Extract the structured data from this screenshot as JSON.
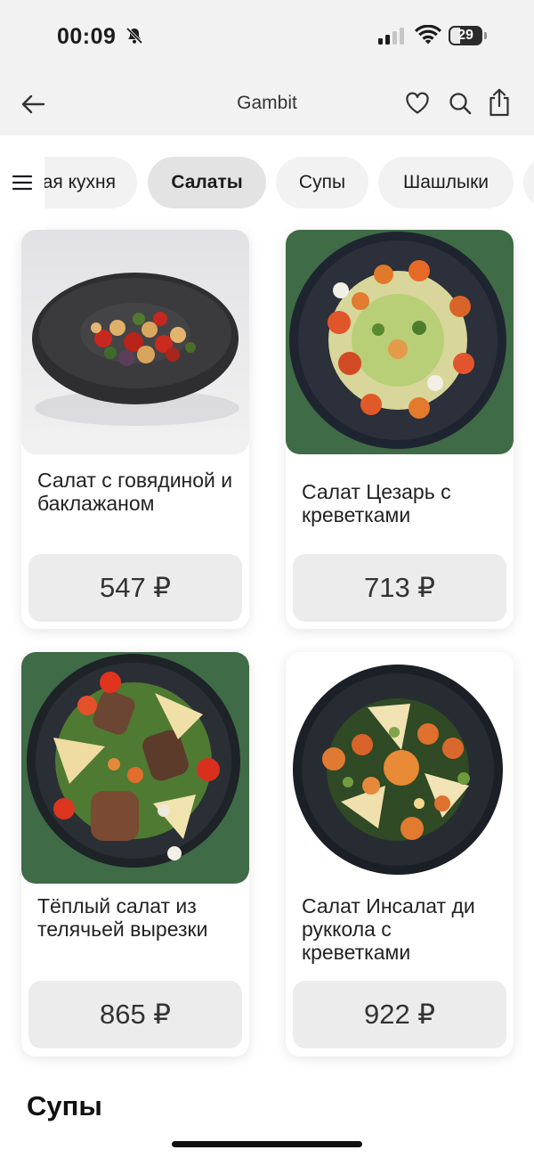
{
  "status_bar": {
    "time": "00:09",
    "battery_level": "29"
  },
  "header": {
    "title": "Gambit"
  },
  "categories": [
    {
      "label": "Европейская кухня",
      "active": false
    },
    {
      "label": "Салаты",
      "active": true
    },
    {
      "label": "Супы",
      "active": false
    },
    {
      "label": "Шашлыки",
      "active": false
    }
  ],
  "products": [
    {
      "name": "Салат с говядиной и баклажаном",
      "price": "547 ₽",
      "background": "#ececec"
    },
    {
      "name": "Салат Цезарь с креветками",
      "price": "713 ₽",
      "background": "#3f6b46"
    },
    {
      "name": "Тёплый салат из телячьей вырезки",
      "price": "865 ₽",
      "background": "#3f6b46"
    },
    {
      "name": "Салат Инсалат ди руккола с креветками",
      "price": "922 ₽",
      "background": "#ffffff"
    }
  ],
  "next_section": {
    "title": "Супы"
  },
  "colors": {
    "chip_active": "#e3e3e3",
    "chip": "#f2f2f2",
    "price_button": "#ececec",
    "green_backdrop": "#3f6b46"
  }
}
